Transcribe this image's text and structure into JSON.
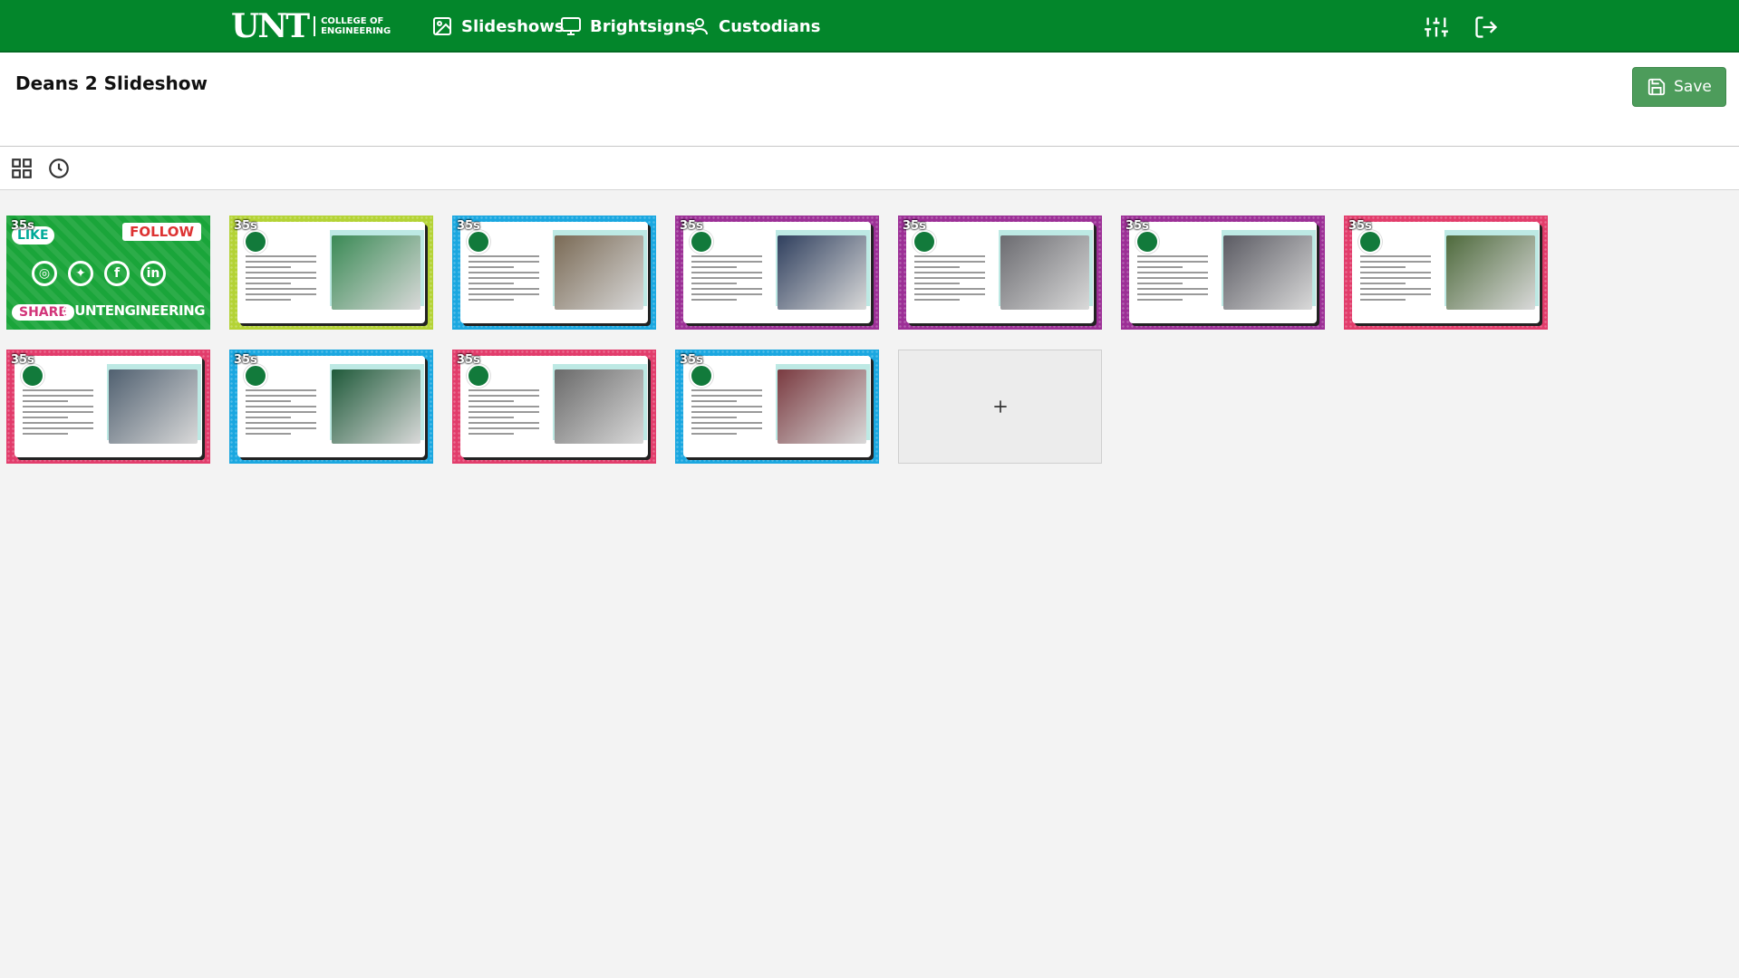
{
  "brand": {
    "name": "UNT",
    "sub_line1": "COLLEGE OF",
    "sub_line2": "ENGINEERING"
  },
  "nav": {
    "items": [
      {
        "label": "Slideshows",
        "icon": "image-icon"
      },
      {
        "label": "Brightsigns",
        "icon": "monitor-icon"
      },
      {
        "label": "Custodians",
        "icon": "user-icon"
      }
    ],
    "settings_icon": "sliders-icon",
    "logout_icon": "logout-icon"
  },
  "page": {
    "title": "Deans 2 Slideshow"
  },
  "actions": {
    "save_label": "Save"
  },
  "toolbar": {
    "grid_icon": "grid-icon",
    "history_icon": "clock-icon"
  },
  "social_slide": {
    "like": "LIKE",
    "follow": "FOLLOW",
    "share": "SHARE",
    "handle": "@UNTENGINEERING"
  },
  "slides": [
    {
      "duration": "35s",
      "border": "#1aa53a",
      "photo": "#2e7d4f"
    },
    {
      "duration": "35s",
      "border": "#b4d335",
      "photo": "#3a8a55"
    },
    {
      "duration": "35s",
      "border": "#1aa7e0",
      "photo": "#7a6a55"
    },
    {
      "duration": "35s",
      "border": "#9c2f96",
      "photo": "#2f3f5e"
    },
    {
      "duration": "35s",
      "border": "#9c2f96",
      "photo": "#6b6b70"
    },
    {
      "duration": "35s",
      "border": "#9c2f96",
      "photo": "#5a5a62"
    },
    {
      "duration": "35s",
      "border": "#e23c6b",
      "photo": "#4e6a3c"
    },
    {
      "duration": "35s",
      "border": "#e23c6b",
      "photo": "#506070"
    },
    {
      "duration": "35s",
      "border": "#1aa7e0",
      "photo": "#1f5a3a"
    },
    {
      "duration": "35s",
      "border": "#e23c6b",
      "photo": "#6a6a6a"
    },
    {
      "duration": "35s",
      "border": "#1aa7e0",
      "photo": "#7a3a40"
    }
  ],
  "add_slide_icon": "plus-icon"
}
